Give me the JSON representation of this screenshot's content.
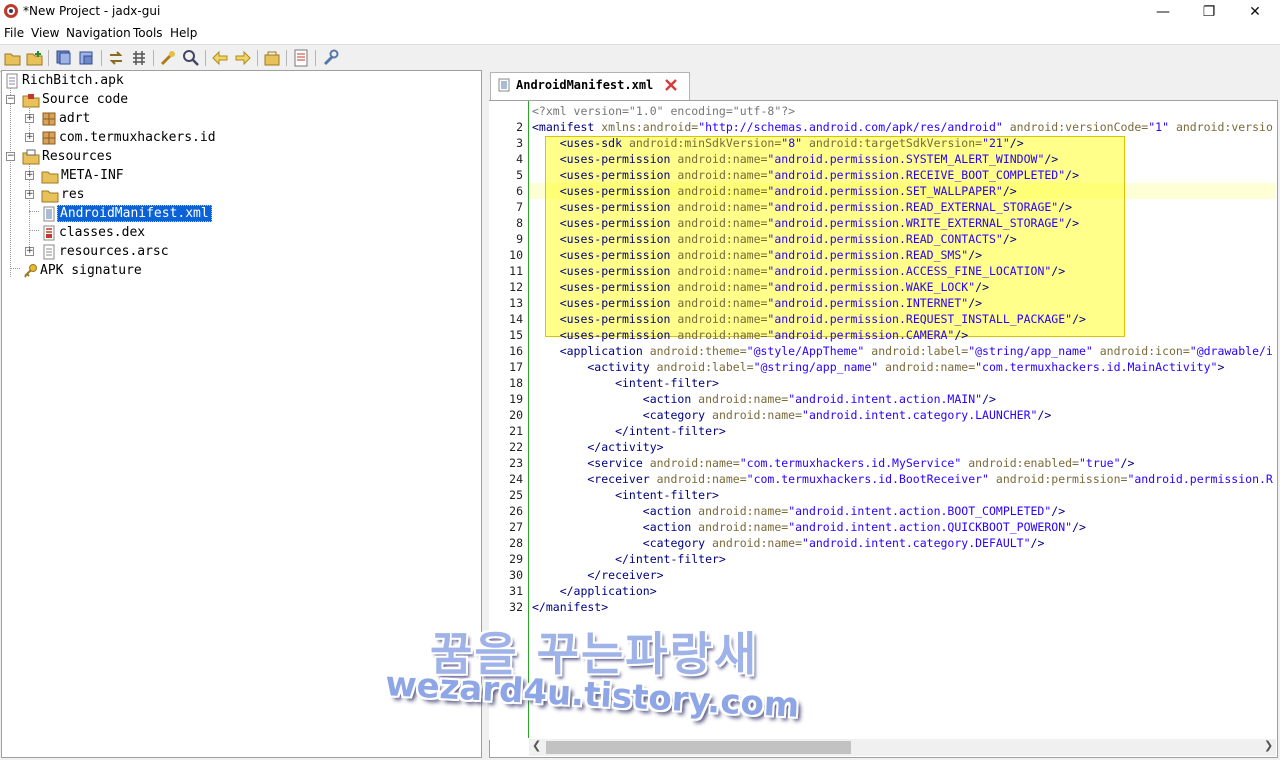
{
  "window": {
    "title": "*New Project - jadx-gui",
    "minimize": "—",
    "maximize": "❐",
    "close": "✕"
  },
  "menu": [
    "File",
    "View",
    "Navigation",
    "Tools",
    "Help"
  ],
  "toolbar_icons": [
    "open-file-icon",
    "add-files-icon",
    "save-all-icon",
    "export-icon",
    "sync-icon",
    "flatten-packages-icon",
    "text-search-icon",
    "class-search-icon",
    "back-icon",
    "forward-icon",
    "decompile-all-icon",
    "log-viewer-icon",
    "preferences-icon"
  ],
  "tree": {
    "root": "RichBitch.apk",
    "source_code": "Source code",
    "pkg_adrt": "adrt",
    "pkg_main": "com.termuxhackers.id",
    "resources": "Resources",
    "meta_inf": "META-INF",
    "res": "res",
    "manifest": "AndroidManifest.xml",
    "classes": "classes.dex",
    "arsc": "resources.arsc",
    "signature": "APK signature"
  },
  "tab": {
    "label": "AndroidManifest.xml"
  },
  "code": {
    "line_numbers": [
      "",
      "2",
      "3",
      "4",
      "5",
      "6",
      "7",
      "8",
      "9",
      "10",
      "11",
      "12",
      "13",
      "14",
      "15",
      "16",
      "17",
      "18",
      "19",
      "20",
      "21",
      "22",
      "23",
      "24",
      "25",
      "26",
      "27",
      "28",
      "29",
      "30",
      "31",
      "32"
    ],
    "current_line": 6,
    "highlight_lines": [
      3,
      15
    ],
    "lines": [
      [
        {
          "c": "p",
          "t": "<?xml version=\"1.0\" encoding=\"utf-8\"?>"
        }
      ],
      [
        {
          "c": "t",
          "t": "<manifest "
        },
        {
          "c": "a",
          "t": "xmlns:android="
        },
        {
          "c": "v",
          "t": "\"http://schemas.android.com/apk/res/android\""
        },
        {
          "c": "a",
          "t": " android:versionCode="
        },
        {
          "c": "v",
          "t": "\"1\""
        },
        {
          "c": "a",
          "t": " android:versio"
        }
      ],
      [
        {
          "c": "t",
          "t": "    <uses-sdk "
        },
        {
          "c": "a",
          "t": "android:minSdkVersion="
        },
        {
          "c": "v",
          "t": "\"8\""
        },
        {
          "c": "a",
          "t": " android:targetSdkVersion="
        },
        {
          "c": "v",
          "t": "\"21\""
        },
        {
          "c": "t",
          "t": "/>"
        }
      ],
      [
        {
          "c": "t",
          "t": "    <uses-permission "
        },
        {
          "c": "a",
          "t": "android:name="
        },
        {
          "c": "v",
          "t": "\"android.permission.SYSTEM_ALERT_WINDOW\""
        },
        {
          "c": "t",
          "t": "/>"
        }
      ],
      [
        {
          "c": "t",
          "t": "    <uses-permission "
        },
        {
          "c": "a",
          "t": "android:name="
        },
        {
          "c": "v",
          "t": "\"android.permission.RECEIVE_BOOT_COMPLETED\""
        },
        {
          "c": "t",
          "t": "/>"
        }
      ],
      [
        {
          "c": "t",
          "t": "    <uses-permission "
        },
        {
          "c": "a",
          "t": "android:name="
        },
        {
          "c": "v",
          "t": "\"android.permission.SET_WALLPAPER\""
        },
        {
          "c": "t",
          "t": "/>"
        }
      ],
      [
        {
          "c": "t",
          "t": "    <uses-permission "
        },
        {
          "c": "a",
          "t": "android:name="
        },
        {
          "c": "v",
          "t": "\"android.permission.READ_EXTERNAL_STORAGE\""
        },
        {
          "c": "t",
          "t": "/>"
        }
      ],
      [
        {
          "c": "t",
          "t": "    <uses-permission "
        },
        {
          "c": "a",
          "t": "android:name="
        },
        {
          "c": "v",
          "t": "\"android.permission.WRITE_EXTERNAL_STORAGE\""
        },
        {
          "c": "t",
          "t": "/>"
        }
      ],
      [
        {
          "c": "t",
          "t": "    <uses-permission "
        },
        {
          "c": "a",
          "t": "android:name="
        },
        {
          "c": "v",
          "t": "\"android.permission.READ_CONTACTS\""
        },
        {
          "c": "t",
          "t": "/>"
        }
      ],
      [
        {
          "c": "t",
          "t": "    <uses-permission "
        },
        {
          "c": "a",
          "t": "android:name="
        },
        {
          "c": "v",
          "t": "\"android.permission.READ_SMS\""
        },
        {
          "c": "t",
          "t": "/>"
        }
      ],
      [
        {
          "c": "t",
          "t": "    <uses-permission "
        },
        {
          "c": "a",
          "t": "android:name="
        },
        {
          "c": "v",
          "t": "\"android.permission.ACCESS_FINE_LOCATION\""
        },
        {
          "c": "t",
          "t": "/>"
        }
      ],
      [
        {
          "c": "t",
          "t": "    <uses-permission "
        },
        {
          "c": "a",
          "t": "android:name="
        },
        {
          "c": "v",
          "t": "\"android.permission.WAKE_LOCK\""
        },
        {
          "c": "t",
          "t": "/>"
        }
      ],
      [
        {
          "c": "t",
          "t": "    <uses-permission "
        },
        {
          "c": "a",
          "t": "android:name="
        },
        {
          "c": "v",
          "t": "\"android.permission.INTERNET\""
        },
        {
          "c": "t",
          "t": "/>"
        }
      ],
      [
        {
          "c": "t",
          "t": "    <uses-permission "
        },
        {
          "c": "a",
          "t": "android:name="
        },
        {
          "c": "v",
          "t": "\"android.permission.REQUEST_INSTALL_PACKAGE\""
        },
        {
          "c": "t",
          "t": "/>"
        }
      ],
      [
        {
          "c": "t",
          "t": "    <uses-permission "
        },
        {
          "c": "a",
          "t": "android:name="
        },
        {
          "c": "v",
          "t": "\"android.permission.CAMERA\""
        },
        {
          "c": "t",
          "t": "/>"
        }
      ],
      [
        {
          "c": "t",
          "t": "    <application "
        },
        {
          "c": "a",
          "t": "android:theme="
        },
        {
          "c": "v",
          "t": "\"@style/AppTheme\""
        },
        {
          "c": "a",
          "t": " android:label="
        },
        {
          "c": "v",
          "t": "\"@string/app_name\""
        },
        {
          "c": "a",
          "t": " android:icon="
        },
        {
          "c": "v",
          "t": "\"@drawable/i"
        }
      ],
      [
        {
          "c": "t",
          "t": "        <activity "
        },
        {
          "c": "a",
          "t": "android:label="
        },
        {
          "c": "v",
          "t": "\"@string/app_name\""
        },
        {
          "c": "a",
          "t": " android:name="
        },
        {
          "c": "v",
          "t": "\"com.termuxhackers.id.MainActivity\""
        },
        {
          "c": "t",
          "t": ">"
        }
      ],
      [
        {
          "c": "t",
          "t": "            <intent-filter>"
        }
      ],
      [
        {
          "c": "t",
          "t": "                <action "
        },
        {
          "c": "a",
          "t": "android:name="
        },
        {
          "c": "v",
          "t": "\"android.intent.action.MAIN\""
        },
        {
          "c": "t",
          "t": "/>"
        }
      ],
      [
        {
          "c": "t",
          "t": "                <category "
        },
        {
          "c": "a",
          "t": "android:name="
        },
        {
          "c": "v",
          "t": "\"android.intent.category.LAUNCHER\""
        },
        {
          "c": "t",
          "t": "/>"
        }
      ],
      [
        {
          "c": "t",
          "t": "            </intent-filter>"
        }
      ],
      [
        {
          "c": "t",
          "t": "        </activity>"
        }
      ],
      [
        {
          "c": "t",
          "t": "        <service "
        },
        {
          "c": "a",
          "t": "android:name="
        },
        {
          "c": "v",
          "t": "\"com.termuxhackers.id.MyService\""
        },
        {
          "c": "a",
          "t": " android:enabled="
        },
        {
          "c": "v",
          "t": "\"true\""
        },
        {
          "c": "t",
          "t": "/>"
        }
      ],
      [
        {
          "c": "t",
          "t": "        <receiver "
        },
        {
          "c": "a",
          "t": "android:name="
        },
        {
          "c": "v",
          "t": "\"com.termuxhackers.id.BootReceiver\""
        },
        {
          "c": "a",
          "t": " android:permission="
        },
        {
          "c": "v",
          "t": "\"android.permission.R"
        }
      ],
      [
        {
          "c": "t",
          "t": "            <intent-filter>"
        }
      ],
      [
        {
          "c": "t",
          "t": "                <action "
        },
        {
          "c": "a",
          "t": "android:name="
        },
        {
          "c": "v",
          "t": "\"android.intent.action.BOOT_COMPLETED\""
        },
        {
          "c": "t",
          "t": "/>"
        }
      ],
      [
        {
          "c": "t",
          "t": "                <action "
        },
        {
          "c": "a",
          "t": "android:name="
        },
        {
          "c": "v",
          "t": "\"android.intent.action.QUICKBOOT_POWERON\""
        },
        {
          "c": "t",
          "t": "/>"
        }
      ],
      [
        {
          "c": "t",
          "t": "                <category "
        },
        {
          "c": "a",
          "t": "android:name="
        },
        {
          "c": "v",
          "t": "\"android.intent.category.DEFAULT\""
        },
        {
          "c": "t",
          "t": "/>"
        }
      ],
      [
        {
          "c": "t",
          "t": "            </intent-filter>"
        }
      ],
      [
        {
          "c": "t",
          "t": "        </receiver>"
        }
      ],
      [
        {
          "c": "t",
          "t": "    </application>"
        }
      ],
      [
        {
          "c": "t",
          "t": "</manifest>"
        }
      ]
    ]
  },
  "watermark": {
    "line1": "꿈을 꾸는파랑새",
    "line2": "wezard4u.tistory.com"
  },
  "colors": {
    "selection": "#0b61d6",
    "highlight": "#ffff28",
    "tag": "#000080",
    "attr": "#7a6a3a",
    "value": "#2a00ff"
  }
}
